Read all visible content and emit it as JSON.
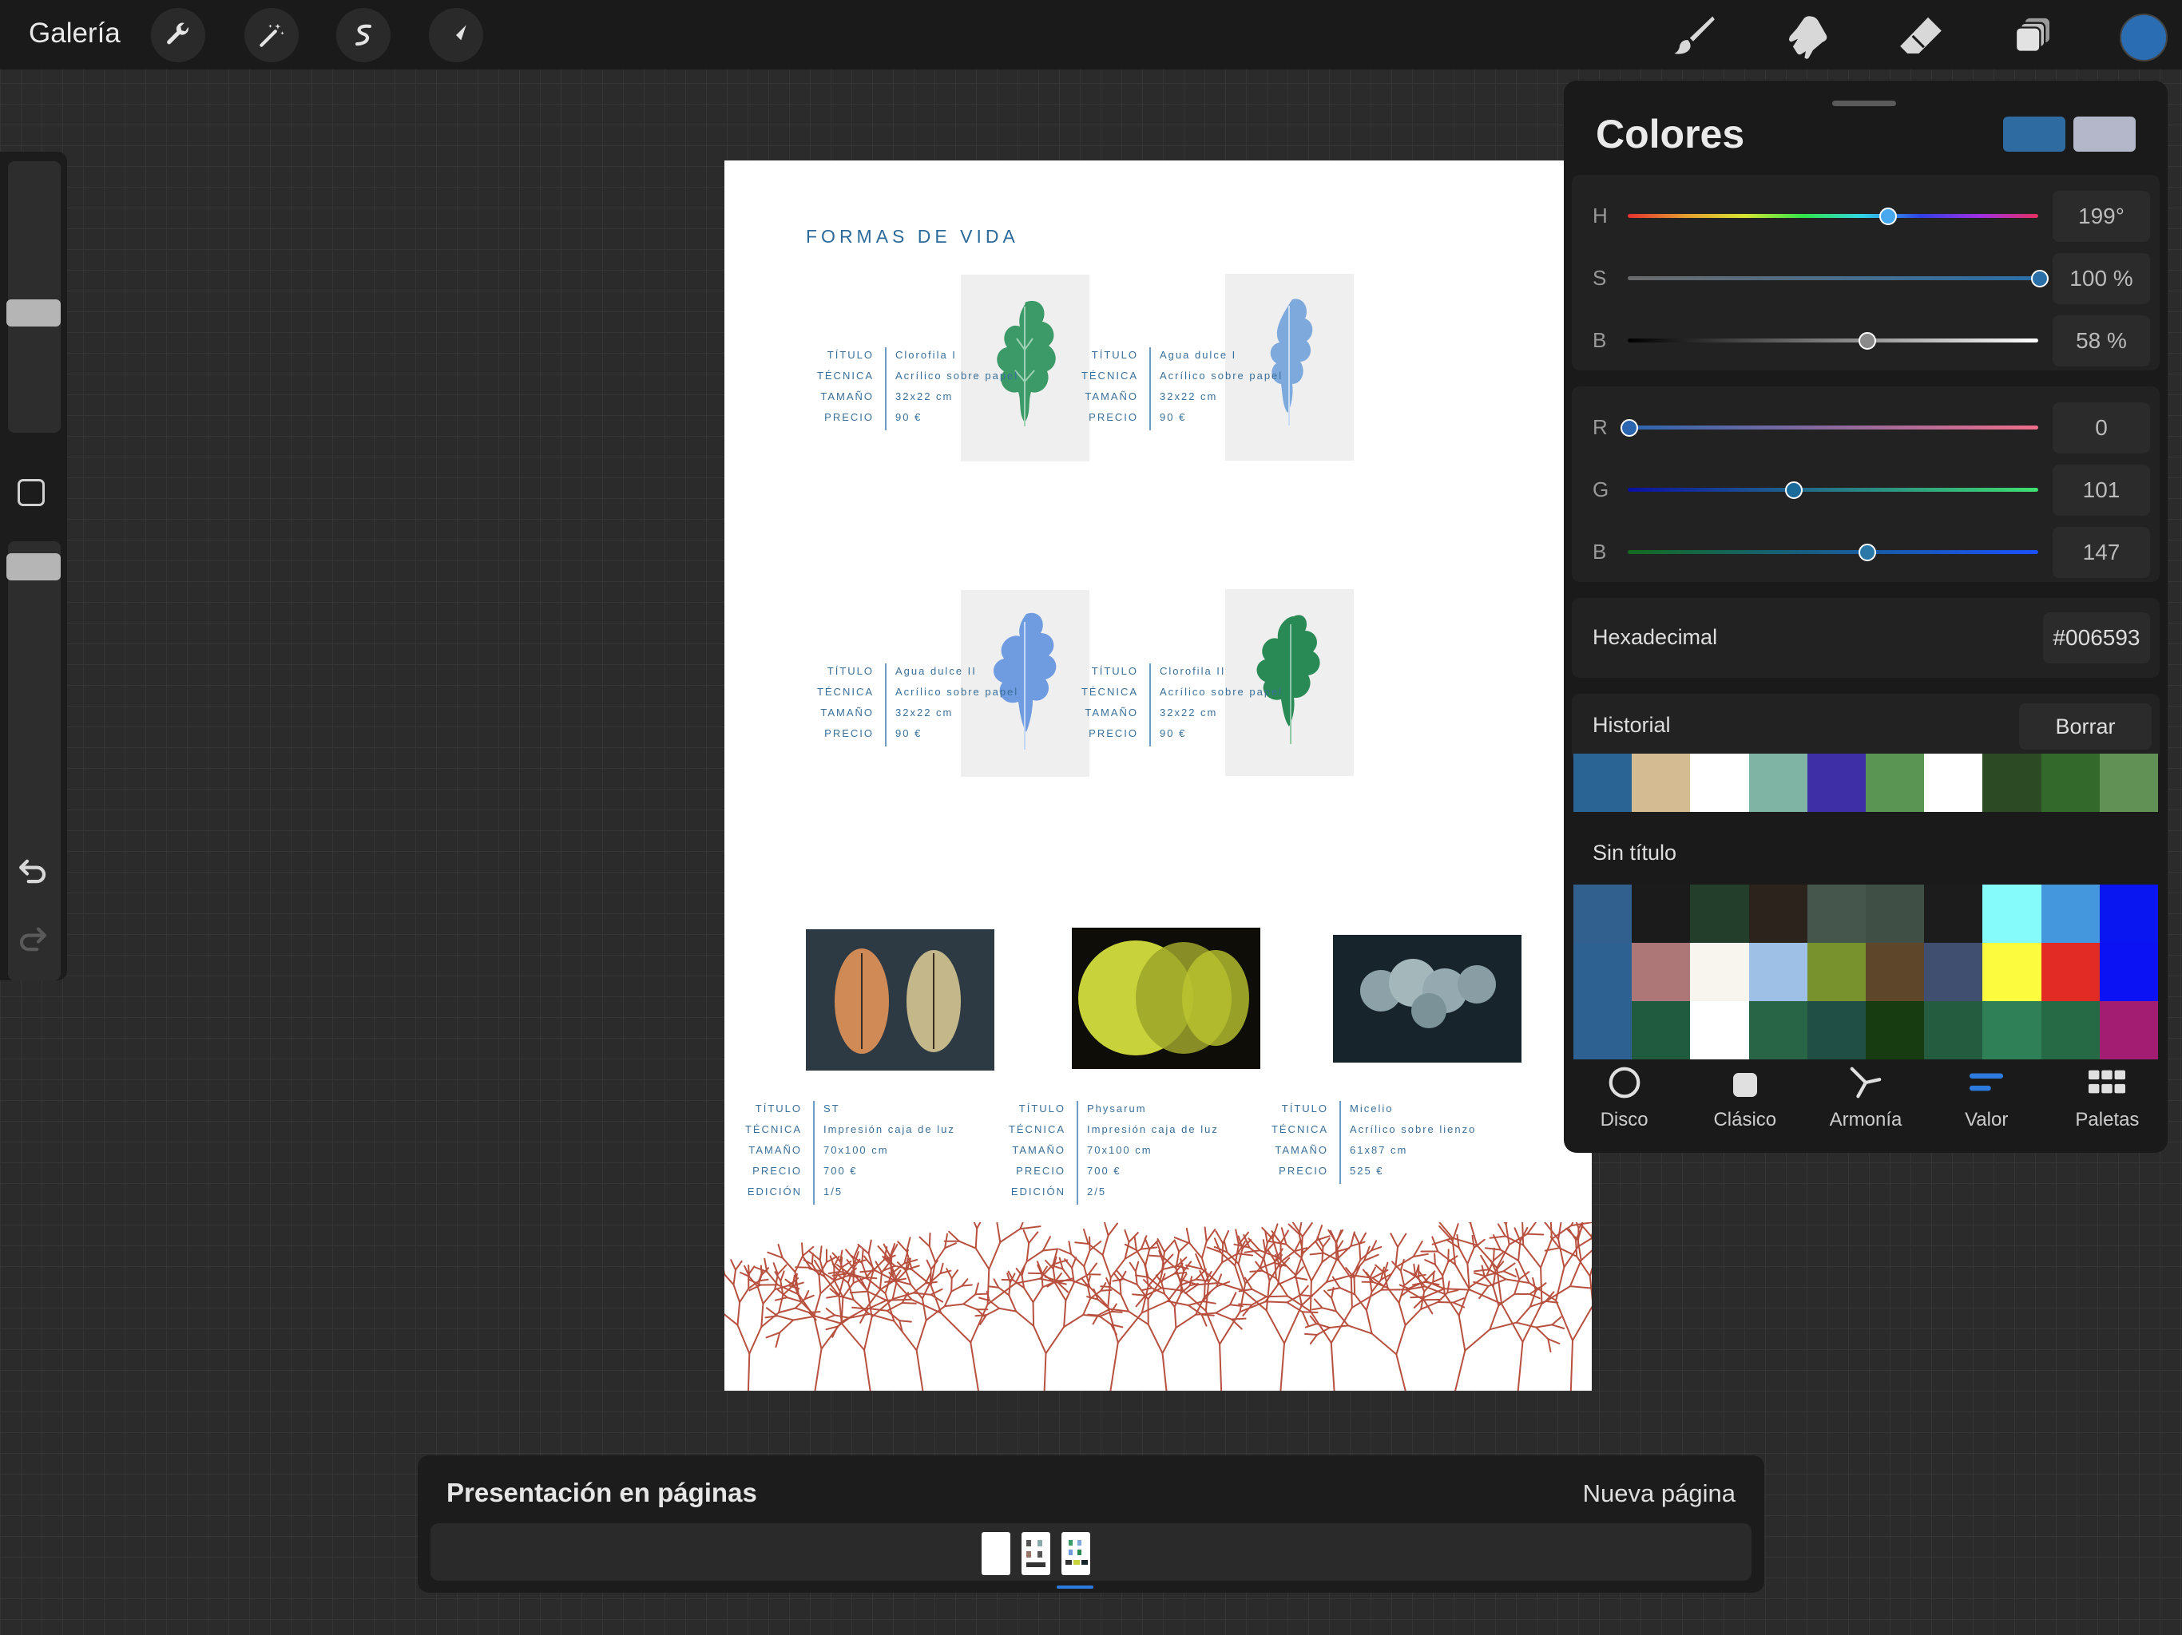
{
  "topbar": {
    "gallery": "Galería",
    "left_tools": [
      "wrench-icon",
      "magic-wand-icon",
      "selection-s-icon",
      "transform-arrow-icon"
    ],
    "right_tools": [
      "brush-icon",
      "smudge-icon",
      "eraser-icon",
      "layers-icon"
    ],
    "current_color": "#2a6db3"
  },
  "document": {
    "title": "FORMAS DE VIDA",
    "labels": {
      "titulo": "TÍTULO",
      "tecnica": "TÉCNICA",
      "tamano": "TAMAÑO",
      "precio": "PRECIO",
      "edicion": "EDICIÓN"
    },
    "works": [
      {
        "titulo": "Clorofila I",
        "tecnica": "Acrílico sobre papel",
        "tamano": "32x22 cm",
        "precio": "90 €"
      },
      {
        "titulo": "Agua dulce I",
        "tecnica": "Acrílico sobre papel",
        "tamano": "32x22 cm",
        "precio": "90 €"
      },
      {
        "titulo": "Agua dulce II",
        "tecnica": "Acrílico sobre papel",
        "tamano": "32x22 cm",
        "precio": "90 €"
      },
      {
        "titulo": "Clorofila II",
        "tecnica": "Acrílico sobre papel",
        "tamano": "32x22 cm",
        "precio": "90 €"
      },
      {
        "titulo": "ST",
        "tecnica": "Impresión caja de luz",
        "tamano": "70x100 cm",
        "precio": "700 €",
        "edicion": "1/5"
      },
      {
        "titulo": "Physarum",
        "tecnica": "Impresión caja de luz",
        "tamano": "70x100 cm",
        "precio": "700 €",
        "edicion": "2/5"
      },
      {
        "titulo": "Micelio",
        "tecnica": "Acrílico sobre lienzo",
        "tamano": "61x87 cm",
        "precio": "525 €"
      }
    ]
  },
  "colors_panel": {
    "title": "Colores",
    "primary_swatch": "#2e6ba0",
    "secondary_swatch": "#b4b7c9",
    "hsb": [
      {
        "label": "H",
        "value": "199°",
        "level": 0.63
      },
      {
        "label": "S",
        "value": "100 %",
        "level": 1.0
      },
      {
        "label": "B",
        "value": "58 %",
        "level": 0.58
      }
    ],
    "rgb": [
      {
        "label": "R",
        "value": "0",
        "level": 0.0
      },
      {
        "label": "G",
        "value": "101",
        "level": 0.4
      },
      {
        "label": "B",
        "value": "147",
        "level": 0.58
      }
    ],
    "hex_label": "Hexadecimal",
    "hex_value": "#006593",
    "history_label": "Historial",
    "clear_button": "Borrar",
    "history_colors": [
      "#2a6494",
      "#d5bb91",
      "#ffffff",
      "#7fb3a3",
      "#3f2fa6",
      "#5a9553",
      "#ffffff",
      "#2c4a24",
      "#336a2c",
      "#629155"
    ],
    "palette_name": "Sin título",
    "palette_rows": [
      [
        "#315f8e",
        "#1b1b1b",
        "#243e2c",
        "#2c241c",
        "#45574d",
        "#3f4f45",
        "#1c1c1c",
        "#86fbfb",
        "#4497dc",
        "#0a16f2"
      ],
      [
        "#2d6191",
        "#ad7677",
        "#f8f5ee",
        "#9ec0e7",
        "#78922e",
        "#5d4629",
        "#404e70",
        "#fcfb3e",
        "#e22b24",
        "#0b12f3"
      ],
      [
        "#2d6191",
        "#205a3f",
        "#ffffff",
        "#276546",
        "#205045",
        "#173c11",
        "#235c3f",
        "#2f8057",
        "#256a45",
        "#a31e73"
      ]
    ],
    "tabs": [
      {
        "label": "Disco",
        "icon": "disc-icon"
      },
      {
        "label": "Clásico",
        "icon": "classic-square-icon"
      },
      {
        "label": "Armonía",
        "icon": "harmony-icon"
      },
      {
        "label": "Valor",
        "icon": "value-sliders-icon"
      },
      {
        "label": "Paletas",
        "icon": "palettes-grid-icon"
      }
    ]
  },
  "pages_panel": {
    "title": "Presentación en páginas",
    "new_page": "Nueva página"
  }
}
